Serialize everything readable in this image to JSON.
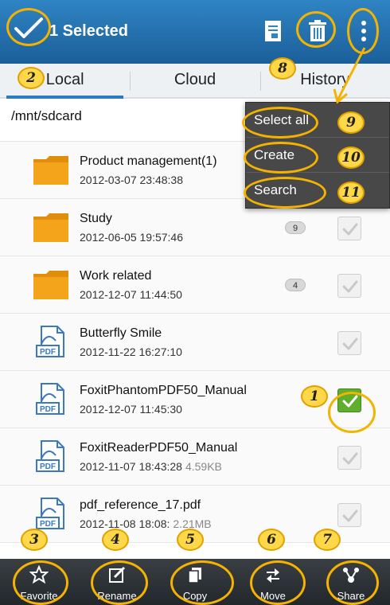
{
  "topbar": {
    "title": "1 Selected",
    "icons": [
      "checkmark-icon",
      "document-icon",
      "trash-icon",
      "overflow-menu-icon"
    ]
  },
  "tabs": [
    {
      "label": "Local",
      "active": true
    },
    {
      "label": "Cloud",
      "active": false
    },
    {
      "label": "History",
      "active": false
    }
  ],
  "path": "/mnt/sdcard",
  "files": [
    {
      "name": "Product management(1)",
      "date": "2012-03-07 23:48:38",
      "type": "folder",
      "count": "",
      "size": "",
      "checked": false
    },
    {
      "name": "Study",
      "date": "2012-06-05 19:57:46",
      "type": "folder",
      "count": "9",
      "size": "",
      "checked": false
    },
    {
      "name": "Work related",
      "date": "2012-12-07 11:44:50",
      "type": "folder",
      "count": "4",
      "size": "",
      "checked": false
    },
    {
      "name": "Butterfly Smile",
      "date": "2012-11-22 16:27:10",
      "type": "pdf",
      "count": "",
      "size": "",
      "checked": false
    },
    {
      "name": "FoxitPhantomPDF50_Manual",
      "date": "2012-12-07 11:45:30",
      "type": "pdf",
      "count": "",
      "size": "",
      "checked": true
    },
    {
      "name": "FoxitReaderPDF50_Manual",
      "date": "2012-11-07 18:43:28",
      "type": "pdf",
      "count": "",
      "size": "4.59KB",
      "checked": false
    },
    {
      "name": "pdf_reference_17.pdf",
      "date": "2012-11-08 18:08:",
      "type": "pdf",
      "count": "",
      "size": "2.21MB",
      "checked": false
    }
  ],
  "pdf_label": "PDF",
  "menu": {
    "items": [
      "Select all",
      "Create",
      "Search"
    ]
  },
  "bottombar": {
    "buttons": [
      {
        "label": "Favorite",
        "icon": "star-icon"
      },
      {
        "label": "Rename",
        "icon": "rename-icon"
      },
      {
        "label": "Copy",
        "icon": "copy-icon"
      },
      {
        "label": "Move",
        "icon": "move-arrows-icon"
      },
      {
        "label": "Share",
        "icon": "share-icon"
      }
    ]
  },
  "annotations": [
    "1",
    "2",
    "3",
    "4",
    "5",
    "6",
    "7",
    "8",
    "9",
    "10",
    "11"
  ],
  "colors": {
    "topbar": "#2f84c3",
    "accent": "#2b7bbf",
    "annotation": "#f3b300",
    "checked": "#5fae2e",
    "folder": "#f4a41a"
  }
}
